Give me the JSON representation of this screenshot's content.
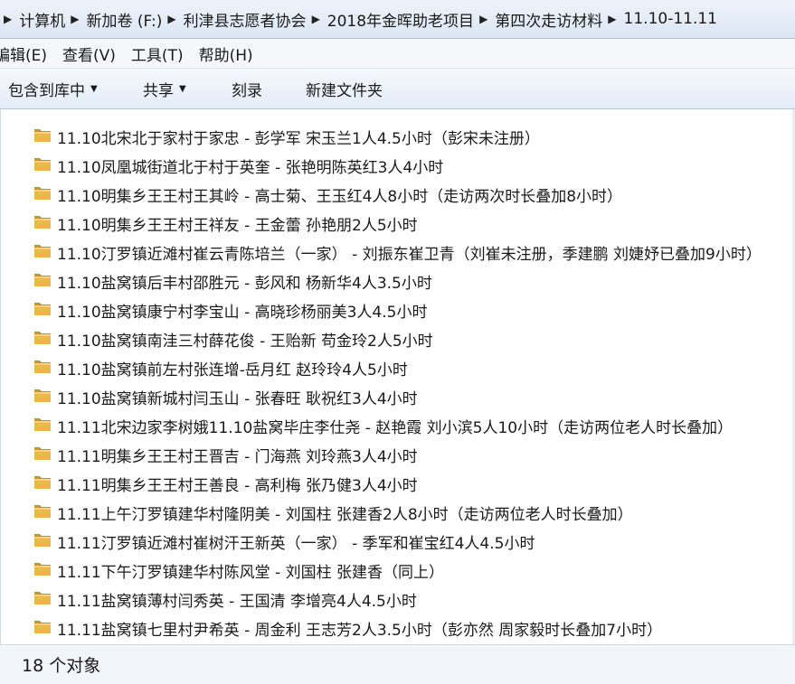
{
  "breadcrumb": [
    "计算机",
    "新加卷 (F:)",
    "利津县志愿者协会",
    "2018年金晖助老项目",
    "第四次走访材料",
    "11.10-11.11"
  ],
  "menu": [
    "编辑(E)",
    "查看(V)",
    "工具(T)",
    "帮助(H)"
  ],
  "toolbar": {
    "include_library": "包含到库中",
    "share": "共享",
    "burn": "刻录",
    "new_folder": "新建文件夹"
  },
  "files": [
    "11.10北宋北于家村于家忠 - 彭学军 宋玉兰1人4.5小时（彭宋未注册）",
    "11.10凤凰城街道北于村于英奎 - 张艳明陈英红3人4小时",
    "11.10明集乡王王村王其岭 - 高士菊、王玉红4人8小时（走访两次时长叠加8小时）",
    "11.10明集乡王王村王祥友 - 王金蕾 孙艳朋2人5小时",
    "11.10汀罗镇近滩村崔云青陈培兰（一家） - 刘振东崔卫青（刘崔未注册，季建鹏 刘婕妤已叠加9小时）",
    "11.10盐窝镇后丰村邵胜元 - 彭风和 杨新华4人3.5小时",
    "11.10盐窝镇康宁村李宝山 - 高晓珍杨丽美3人4.5小时",
    "11.10盐窝镇南洼三村薛花俊 - 王贻新 苟金玲2人5小时",
    "11.10盐窝镇前左村张连增-岳月红 赵玲玲4人5小时",
    "11.10盐窝镇新城村闫玉山 - 张春旺 耿祝红3人4小时",
    "11.11北宋边家李树娥11.10盐窝毕庄李仕尧 - 赵艳霞 刘小滨5人10小时（走访两位老人时长叠加）",
    "11.11明集乡王王村王晋吉 - 门海燕 刘玲燕3人4小时",
    "11.11明集乡王王村王善良 - 高利梅 张乃健3人4小时",
    "11.11上午汀罗镇建华村隆阴美 - 刘国柱 张建香2人8小时（走访两位老人时长叠加）",
    "11.11汀罗镇近滩村崔树汗王新英（一家） - 季军和崔宝红4人4.5小时",
    "11.11下午汀罗镇建华村陈风堂 - 刘国柱 张建香（同上）",
    "11.11盐窝镇薄村闫秀英 - 王国清  李增亮4人4.5小时",
    "11.11盐窝镇七里村尹希英 - 周金利 王志芳2人3.5小时（彭亦然 周家毅时长叠加7小时）"
  ],
  "status": {
    "object_count": "18 个对象"
  },
  "colors": {
    "folder": "#e8b84a",
    "folder_dark": "#c99326",
    "chrome": "#dbe6f4"
  }
}
